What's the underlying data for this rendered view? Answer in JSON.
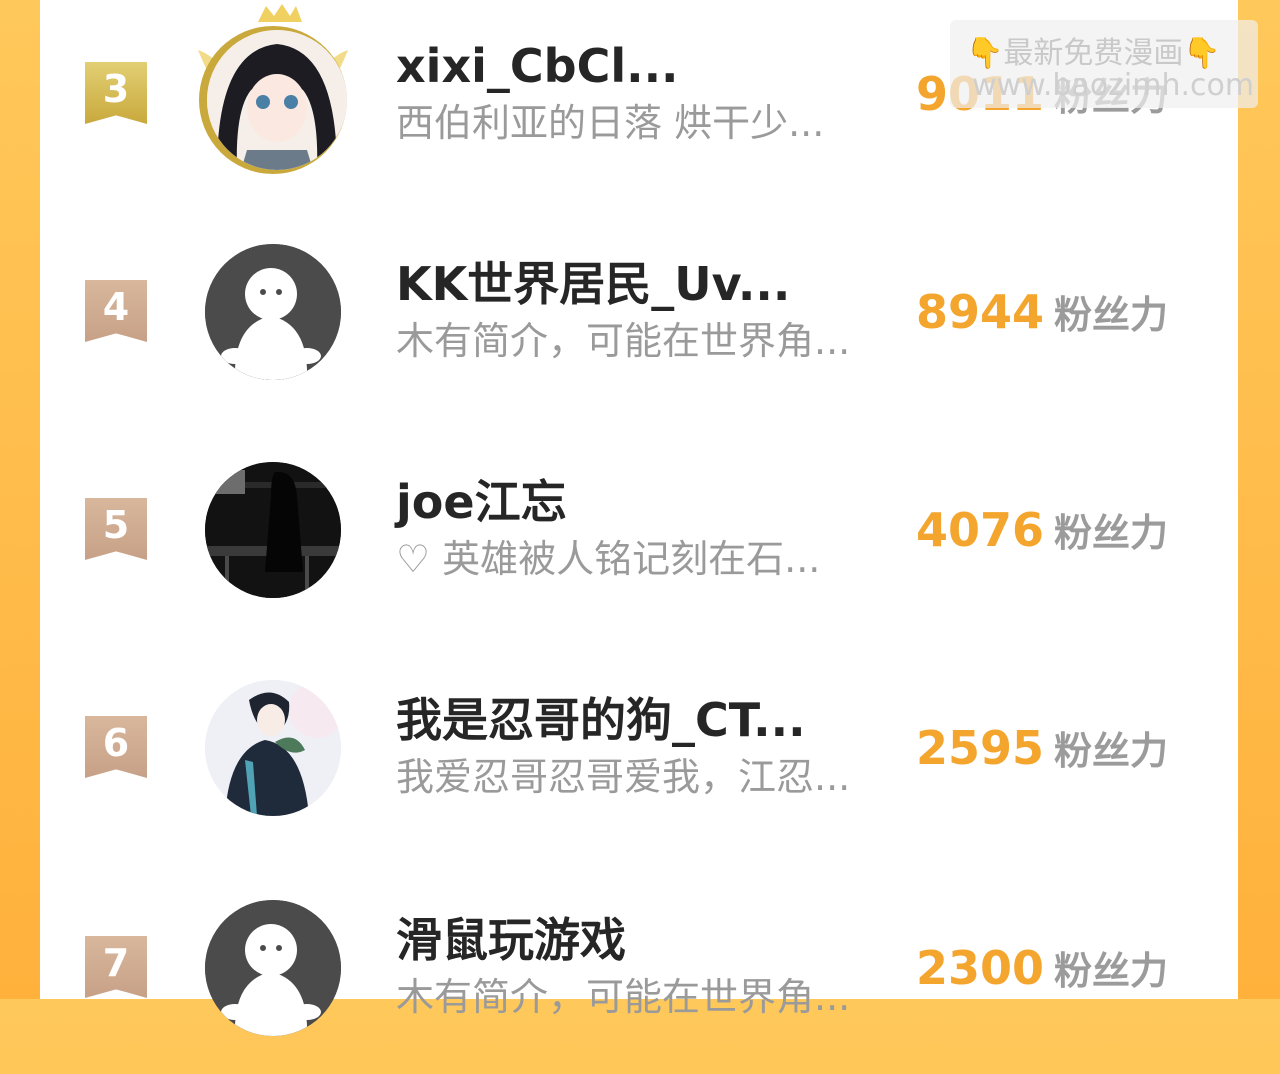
{
  "rankings": [
    {
      "rank": "3",
      "username": "xixi_CbCl...",
      "bio": "西伯利亚的日落 烘干少...",
      "score": "9011",
      "score_unit": "粉丝力"
    },
    {
      "rank": "4",
      "username": "KK世界居民_Uv...",
      "bio": "木有简介，可能在世界角...",
      "score": "8944",
      "score_unit": "粉丝力"
    },
    {
      "rank": "5",
      "username": "joe江忘",
      "bio": "♡ 英雄被人铭记刻在石...",
      "score": "4076",
      "score_unit": "粉丝力"
    },
    {
      "rank": "6",
      "username": "我是忍哥的狗_CT...",
      "bio": "我爱忍哥忍哥爱我，江忍...",
      "score": "2595",
      "score_unit": "粉丝力"
    },
    {
      "rank": "7",
      "username": "滑鼠玩游戏",
      "bio": "木有简介，可能在世界角...",
      "score": "2300",
      "score_unit": "粉丝力"
    }
  ],
  "watermark": {
    "line1": "👇最新免费漫画👇",
    "line2": "www.baozimh.com"
  },
  "colors": {
    "score": "#f3a52e",
    "gold_badge": "#d4b84e",
    "bronze_badge": "#cda78c",
    "background": "#ffb845"
  }
}
